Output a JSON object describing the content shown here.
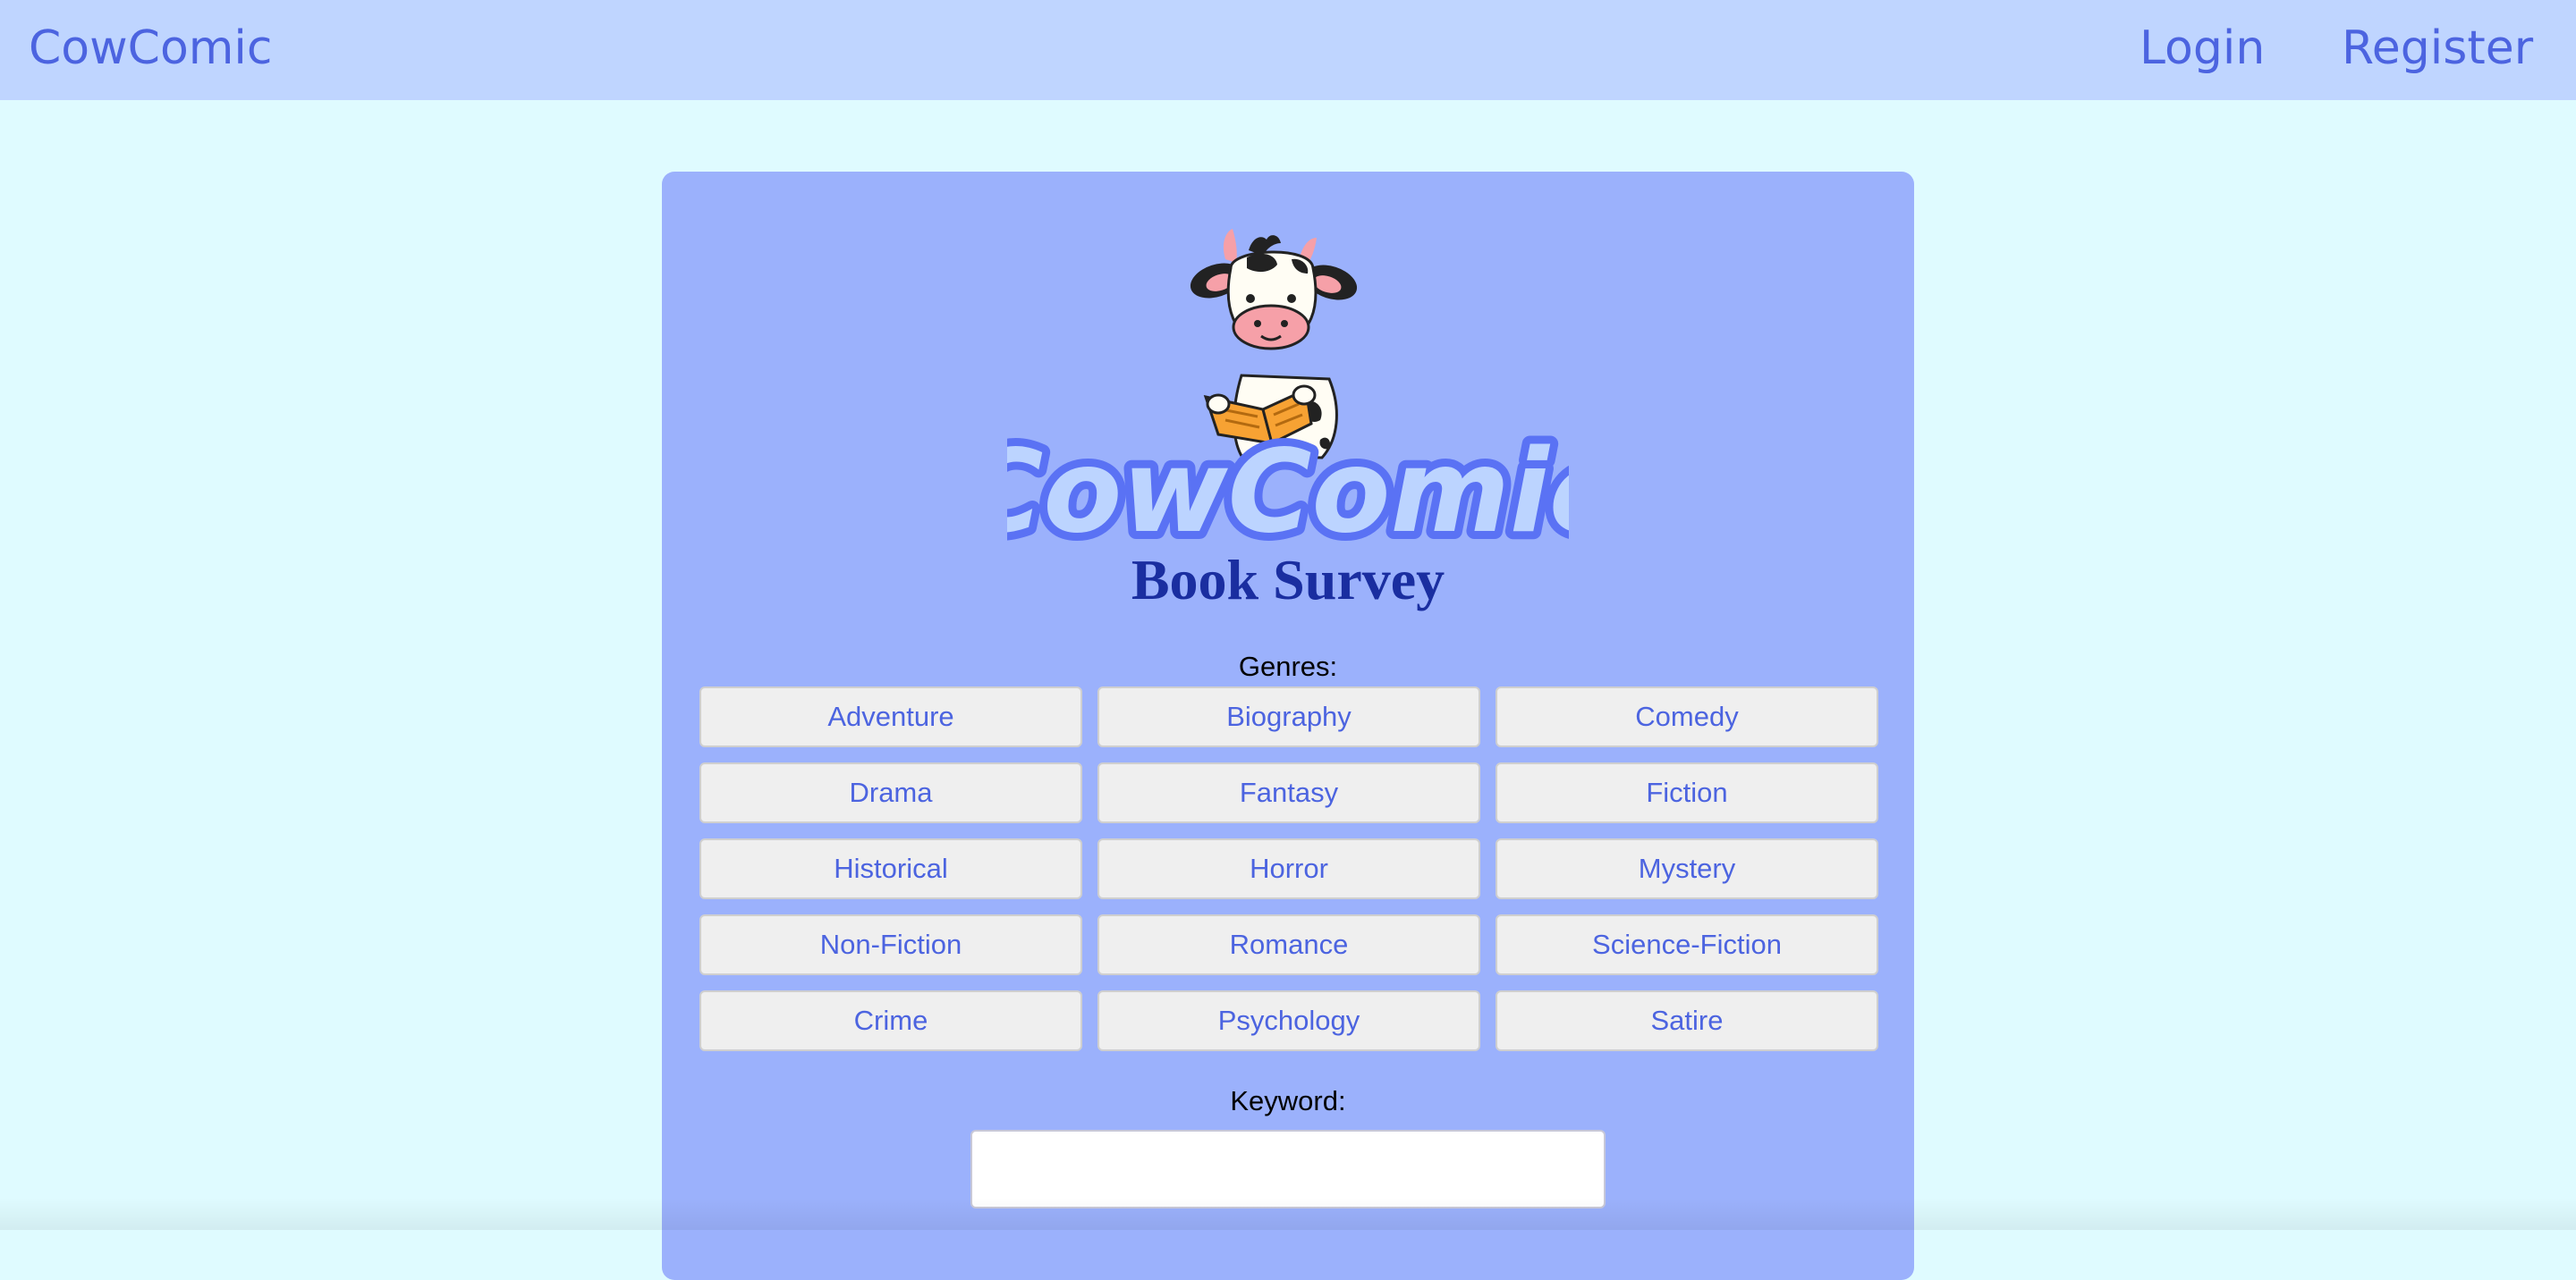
{
  "nav": {
    "brand": "CowComic",
    "links": [
      "Login",
      "Register"
    ]
  },
  "logo": {
    "text": "CowComic",
    "icon": "cow-reading-book-icon"
  },
  "survey": {
    "title": "Book Survey",
    "genres_label": "Genres:",
    "genres": [
      "Adventure",
      "Biography",
      "Comedy",
      "Drama",
      "Fantasy",
      "Fiction",
      "Historical",
      "Horror",
      "Mystery",
      "Non-Fiction",
      "Romance",
      "Science-Fiction",
      "Crime",
      "Psychology",
      "Satire"
    ],
    "keyword_label": "Keyword:",
    "keyword_value": "",
    "keyword_placeholder": ""
  },
  "colors": {
    "page_bg": "#dffbff",
    "topbar_bg": "#bfd5ff",
    "card_bg": "#9bb1fc",
    "accent": "#4c64e0",
    "title": "#1a2ea0"
  }
}
